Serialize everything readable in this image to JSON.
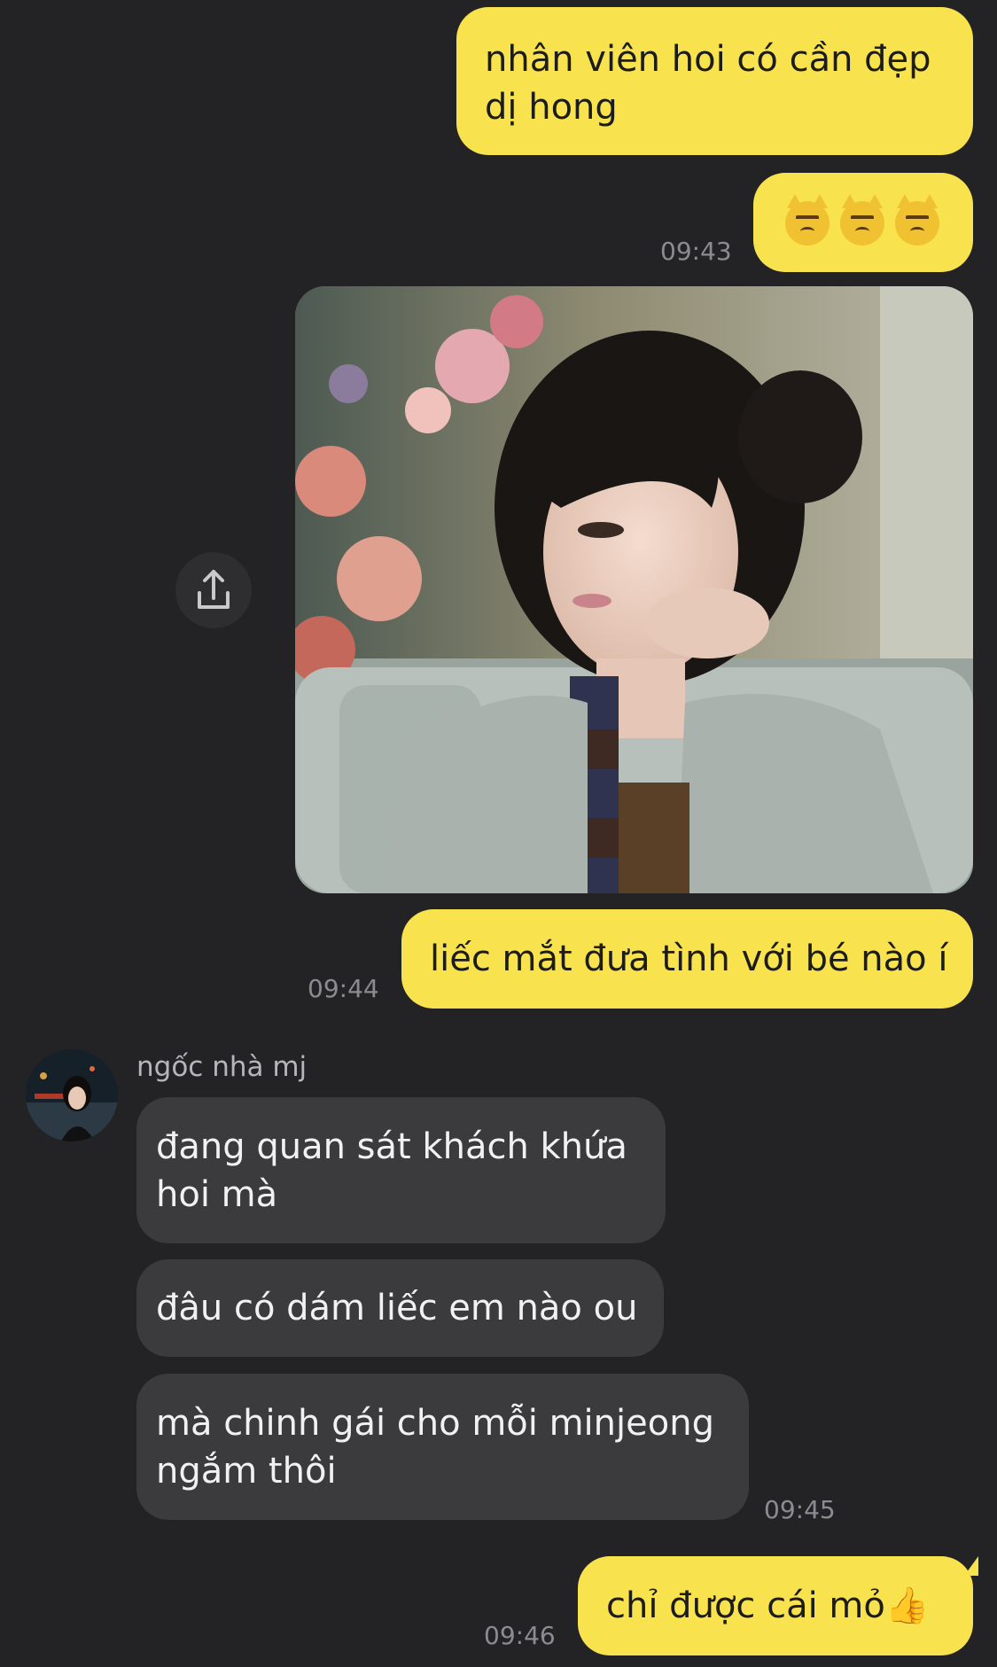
{
  "messages": {
    "m1_line1": "nhân viên hoi có cần đẹp",
    "m1_line2": "dị hong",
    "m2_emoji_names": [
      "pouting-cat-icon",
      "pouting-cat-icon",
      "pouting-cat-icon"
    ],
    "time_1": "09:43",
    "m4": "liếc mắt đưa tình với bé nào í",
    "time_2": "09:44",
    "sender_name": "ngốc nhà mj",
    "m5_line1": "đang quan sát khách khứa",
    "m5_line2": "hoi mà",
    "m6": "đâu có dám liếc em nào ou",
    "m7_line1": "mà chinh gái cho mỗi minjeong",
    "m7_line2": "ngắm thôi",
    "time_3": "09:45",
    "m8_text": "chỉ được cái mỏ",
    "m8_emoji": "👍",
    "time_4": "09:46"
  },
  "colors": {
    "background": "#232325",
    "outgoing_bubble": "#f8e24e",
    "incoming_bubble": "#3b3b3e",
    "timestamp": "#8c8c90"
  }
}
